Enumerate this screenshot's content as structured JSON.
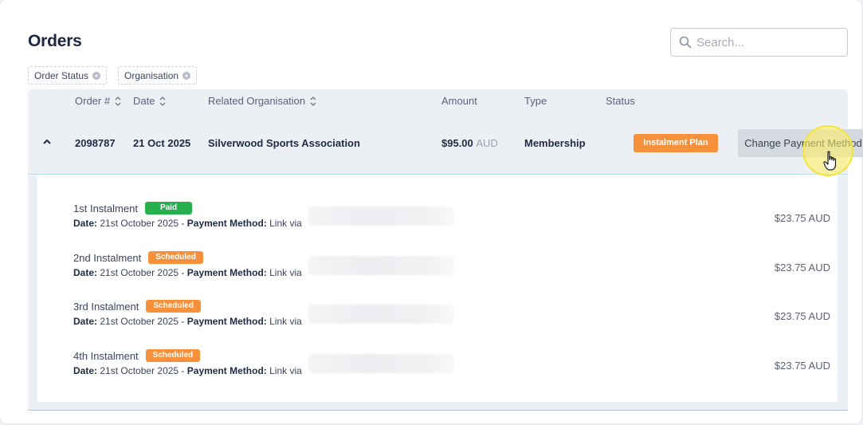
{
  "page": {
    "title": "Orders"
  },
  "search": {
    "placeholder": "Search..."
  },
  "filters": [
    {
      "label": "Order Status"
    },
    {
      "label": "Organisation"
    }
  ],
  "table": {
    "columns": [
      "Order #",
      "Date",
      "Related Organisation",
      "Amount",
      "Type",
      "Status"
    ],
    "rows": [
      {
        "order_number": "2098787",
        "date": "21 Oct 2025",
        "organisation": "Silverwood Sports Association",
        "amount": "$95.00",
        "currency": "AUD",
        "type": "Membership",
        "status": "Instalment Plan",
        "action_label": "Change Payment Method"
      }
    ]
  },
  "instalments": [
    {
      "name": "1st Instalment",
      "badge": "Paid",
      "date_label": "Date:",
      "date": "21st October 2025 -",
      "method_label": "Payment Method:",
      "method": "Link via",
      "amount": "$23.75 AUD"
    },
    {
      "name": "2nd Instalment",
      "badge": "Scheduled",
      "date_label": "Date:",
      "date": "21st October 2025 -",
      "method_label": "Payment Method:",
      "method": "Link via",
      "amount": "$23.75 AUD"
    },
    {
      "name": "3rd Instalment",
      "badge": "Scheduled",
      "date_label": "Date:",
      "date": "21st October 2025 -",
      "method_label": "Payment Method:",
      "method": "Link via",
      "amount": "$23.75 AUD"
    },
    {
      "name": "4th Instalment",
      "badge": "Scheduled",
      "date_label": "Date:",
      "date": "21st October 2025 -",
      "method_label": "Payment Method:",
      "method": "Link via",
      "amount": "$23.75 AUD"
    }
  ],
  "colors": {
    "paid": "#27b04e",
    "scheduled": "#f7903a",
    "row_bg": "#eceff4",
    "cursor_highlight": "#f3e43a"
  },
  "icons": [
    "search-icon",
    "sort-icon",
    "chevron-up-icon",
    "plus-icon",
    "hand-cursor-icon"
  ]
}
